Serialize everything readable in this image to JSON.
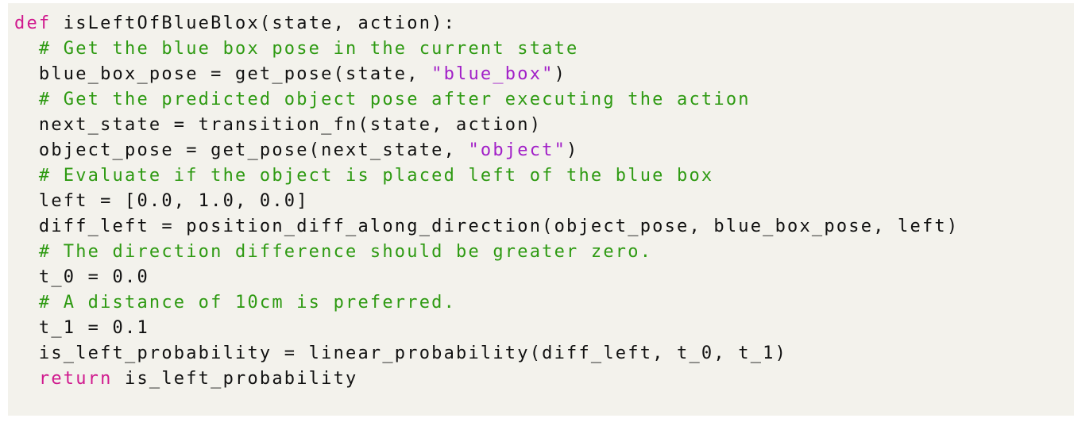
{
  "colors": {
    "background": "#f3f2ec",
    "keyword": "#d01a8e",
    "string": "#a220c8",
    "comment": "#2e9a12",
    "text": "#111111"
  },
  "code": {
    "lines": [
      [
        {
          "t": "kw",
          "v": "def"
        },
        {
          "t": "pl",
          "v": " isLeftOfBlueBlox(state, action):"
        }
      ],
      [
        {
          "t": "pl",
          "v": "  "
        },
        {
          "t": "cm",
          "v": "# Get the blue box pose in the current state"
        }
      ],
      [
        {
          "t": "pl",
          "v": "  blue_box_pose = get_pose(state, "
        },
        {
          "t": "str",
          "v": "\"blue_box\""
        },
        {
          "t": "pl",
          "v": ")"
        }
      ],
      [
        {
          "t": "pl",
          "v": "  "
        },
        {
          "t": "cm",
          "v": "# Get the predicted object pose after executing the action"
        }
      ],
      [
        {
          "t": "pl",
          "v": "  next_state = transition_fn(state, action)"
        }
      ],
      [
        {
          "t": "pl",
          "v": "  object_pose = get_pose(next_state, "
        },
        {
          "t": "str",
          "v": "\"object\""
        },
        {
          "t": "pl",
          "v": ")"
        }
      ],
      [
        {
          "t": "pl",
          "v": "  "
        },
        {
          "t": "cm",
          "v": "# Evaluate if the object is placed left of the blue box"
        }
      ],
      [
        {
          "t": "pl",
          "v": "  left = [0.0, 1.0, 0.0]"
        }
      ],
      [
        {
          "t": "pl",
          "v": "  diff_left = position_diff_along_direction(object_pose, blue_box_pose, left)"
        }
      ],
      [
        {
          "t": "pl",
          "v": "  "
        },
        {
          "t": "cm",
          "v": "# The direction difference should be greater zero."
        }
      ],
      [
        {
          "t": "pl",
          "v": "  t_0 = 0.0"
        }
      ],
      [
        {
          "t": "pl",
          "v": "  "
        },
        {
          "t": "cm",
          "v": "# A distance of 10cm is preferred."
        }
      ],
      [
        {
          "t": "pl",
          "v": "  t_1 = 0.1"
        }
      ],
      [
        {
          "t": "pl",
          "v": "  is_left_probability = linear_probability(diff_left, t_0, t_1)"
        }
      ],
      [
        {
          "t": "pl",
          "v": "  "
        },
        {
          "t": "kw",
          "v": "return"
        },
        {
          "t": "pl",
          "v": " is_left_probability"
        }
      ]
    ]
  }
}
